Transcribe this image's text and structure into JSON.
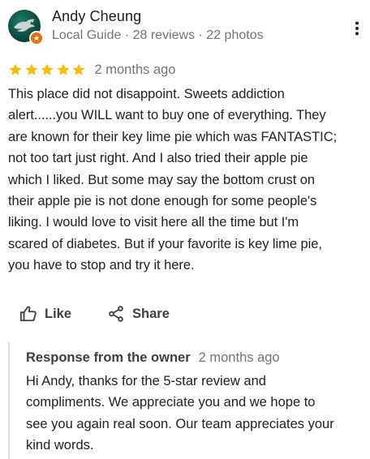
{
  "reviewer": {
    "name": "Andy Cheung",
    "meta": "Local Guide · 28 reviews · 22 photos",
    "avatar_icon": "eagle-logo-icon",
    "badge_icon": "local-guide-badge-icon"
  },
  "review": {
    "rating": 5,
    "rating_max": 5,
    "date": "2 months ago",
    "text": "This place did not disappoint. Sweets addiction\nalert......you WILL want to buy one of everything. They\nare known for their key lime pie which was FANTASTIC;\nnot too tart just right. And I also tried their apple pie\nwhich I liked. But some may say the bottom crust on\ntheir apple pie is not done enough for some people's\nliking. I would love to visit here all the time but I'm\nscared of diabetes. But if your favorite is key lime pie,\nyou have to stop and try it here."
  },
  "actions": {
    "like_label": "Like",
    "share_label": "Share"
  },
  "owner_response": {
    "heading": "Response from the owner",
    "date": "2 months ago",
    "text": "Hi Andy, thanks for the 5-star review and\ncompliments. We appreciate you and we hope to\nsee you again real soon. Our team appreciates your\nkind words."
  },
  "colors": {
    "star": "#fbbc04",
    "badge": "#e8710a",
    "secondary_text": "#70757a",
    "primary_text": "#202124",
    "divider": "#dadce0"
  }
}
